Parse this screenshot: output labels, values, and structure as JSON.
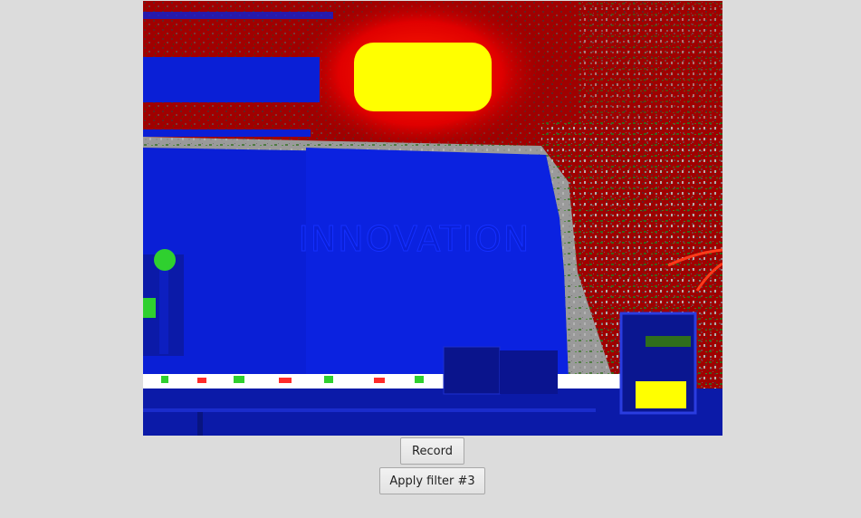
{
  "video": {
    "description_visible_text": "INNOVATION"
  },
  "controls": {
    "record_label": "Record",
    "filter_label": "Apply filter #3"
  },
  "colors": {
    "window_bg": "#dcdcdc",
    "filter_primary_blue": "#0a1fd6",
    "filter_red": "#a30000",
    "filter_hot_yellow": "#ffff00"
  }
}
